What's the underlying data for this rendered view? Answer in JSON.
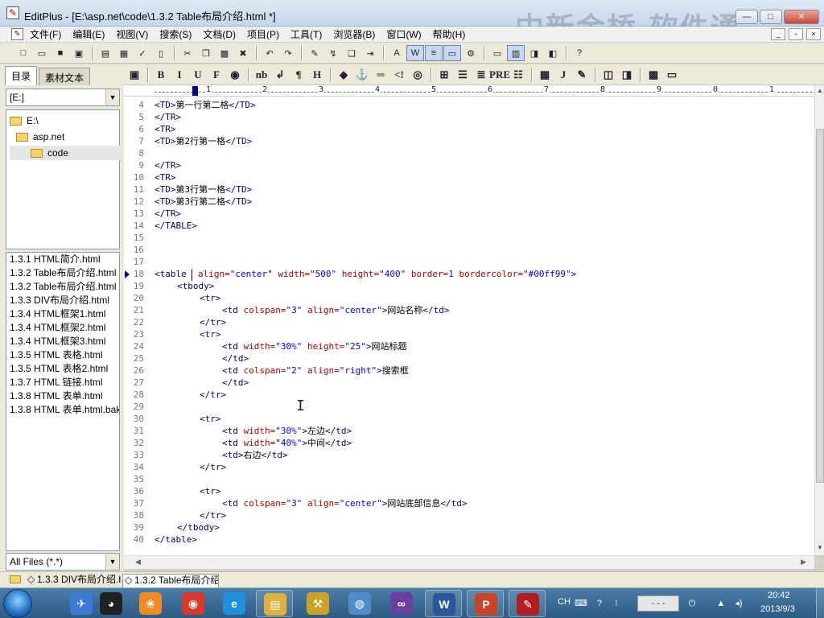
{
  "window": {
    "title": "EditPlus - [E:\\asp.net\\code\\1.3.2 Table布局介绍.html *]",
    "watermark": "中新金桥  软件通",
    "controls": {
      "minimize": "—",
      "maximize": "□",
      "close": "✕"
    }
  },
  "menu": {
    "items": [
      "文件(F)",
      "编辑(E)",
      "视图(V)",
      "搜索(S)",
      "文档(D)",
      "项目(P)",
      "工具(T)",
      "浏览器(B)",
      "窗口(W)",
      "帮助(H)"
    ],
    "mdi_controls": [
      "_",
      "▫",
      "×"
    ]
  },
  "toolbar1": {
    "icons": [
      {
        "name": "new-file-icon",
        "glyph": "□",
        "group_end": false
      },
      {
        "name": "open-file-icon",
        "glyph": "▭",
        "group_end": false
      },
      {
        "name": "save-icon",
        "glyph": "■",
        "group_end": false
      },
      {
        "name": "save-all-icon",
        "glyph": "▣",
        "group_end": true
      },
      {
        "name": "print-preview-icon",
        "glyph": "▤",
        "group_end": false
      },
      {
        "name": "print-icon",
        "glyph": "▦",
        "group_end": false
      },
      {
        "name": "spellcheck-icon",
        "glyph": "✓",
        "group_end": false
      },
      {
        "name": "page-icon",
        "glyph": "▯",
        "group_end": true
      },
      {
        "name": "cut-icon",
        "glyph": "✂",
        "group_end": false
      },
      {
        "name": "copy-icon",
        "glyph": "❐",
        "group_end": false
      },
      {
        "name": "paste-icon",
        "glyph": "▩",
        "group_end": false
      },
      {
        "name": "delete-icon",
        "glyph": "✖",
        "group_end": true
      },
      {
        "name": "undo-icon",
        "glyph": "↶",
        "group_end": false
      },
      {
        "name": "redo-icon",
        "glyph": "↷",
        "group_end": true
      },
      {
        "name": "find-icon",
        "glyph": "✎",
        "group_end": false
      },
      {
        "name": "replace-icon",
        "glyph": "↯",
        "group_end": false
      },
      {
        "name": "find-in-files-icon",
        "glyph": "❏",
        "group_end": false
      },
      {
        "name": "goto-icon",
        "glyph": "⇥",
        "group_end": true
      },
      {
        "name": "font-icon",
        "glyph": "A",
        "group_end": false
      },
      {
        "name": "word-wrap-icon",
        "glyph": "W",
        "group_end": false,
        "active": true
      },
      {
        "name": "line-number-icon",
        "glyph": "≡",
        "group_end": false,
        "active": true
      },
      {
        "name": "ruler-icon",
        "glyph": "▭",
        "group_end": false,
        "active": true
      },
      {
        "name": "settings-icon",
        "glyph": "⚙",
        "group_end": true
      },
      {
        "name": "window-icon",
        "glyph": "▭",
        "group_end": false
      },
      {
        "name": "tile-icon",
        "glyph": "▥",
        "group_end": false,
        "active": true
      },
      {
        "name": "browser-icon",
        "glyph": "◨",
        "group_end": false
      },
      {
        "name": "cliptext-icon",
        "glyph": "◧",
        "group_end": true
      },
      {
        "name": "help-icon",
        "glyph": "?",
        "group_end": false
      }
    ]
  },
  "toolbar2": {
    "icons": [
      {
        "name": "html-toolbar-icon",
        "glyph": "▣",
        "group_end": true
      },
      {
        "name": "bold-icon",
        "glyph": "B",
        "group_end": false
      },
      {
        "name": "italic-icon",
        "glyph": "I",
        "group_end": false
      },
      {
        "name": "underline-icon",
        "glyph": "U",
        "group_end": false
      },
      {
        "name": "font-tag-icon",
        "glyph": "F",
        "group_end": false
      },
      {
        "name": "color-icon",
        "glyph": "◉",
        "group_end": true
      },
      {
        "name": "nbsp-icon",
        "glyph": "nb",
        "group_end": false
      },
      {
        "name": "break-icon",
        "glyph": "↲",
        "group_end": false
      },
      {
        "name": "paragraph-icon",
        "glyph": "¶",
        "group_end": false
      },
      {
        "name": "heading-icon",
        "glyph": "H",
        "group_end": true
      },
      {
        "name": "link-icon",
        "glyph": "◆",
        "group_end": false
      },
      {
        "name": "anchor-icon",
        "glyph": "⚓",
        "group_end": false
      },
      {
        "name": "hr-icon",
        "glyph": "═",
        "group_end": false
      },
      {
        "name": "comment-icon",
        "glyph": "<!",
        "group_end": false
      },
      {
        "name": "image-icon",
        "glyph": "◎",
        "group_end": true
      },
      {
        "name": "table-icon",
        "glyph": "⊞",
        "group_end": false
      },
      {
        "name": "center-icon",
        "glyph": "☰",
        "group_end": false
      },
      {
        "name": "right-align-icon",
        "glyph": "≣",
        "group_end": false
      },
      {
        "name": "pre-icon",
        "glyph": "PRE",
        "group_end": false
      },
      {
        "name": "list-icon",
        "glyph": "☷",
        "group_end": true
      },
      {
        "name": "style-icon",
        "glyph": "▦",
        "group_end": false
      },
      {
        "name": "javascript-icon",
        "glyph": "J",
        "group_end": false
      },
      {
        "name": "script-icon",
        "glyph": "✎",
        "group_end": true
      },
      {
        "name": "form-icon",
        "glyph": "◫",
        "group_end": false
      },
      {
        "name": "input-icon",
        "glyph": "◨",
        "group_end": true
      },
      {
        "name": "color-picker-icon",
        "glyph": "▩",
        "group_end": false
      },
      {
        "name": "preview-icon",
        "glyph": "▭",
        "group_end": false
      }
    ]
  },
  "sidebar": {
    "tabs": [
      {
        "label": "目录",
        "active": true
      },
      {
        "label": "素材文本",
        "active": false
      }
    ],
    "drive": "[E:]",
    "tree": [
      {
        "label": "E:\\",
        "indent": 0,
        "selected": false
      },
      {
        "label": "asp.net",
        "indent": 1,
        "selected": false
      },
      {
        "label": "code",
        "indent": 2,
        "selected": true
      }
    ],
    "files": [
      "1.3.1 HTML简介.html",
      "1.3.2 Table布局介绍.html",
      "1.3.2 Table布局介绍.html",
      "1.3.3 DIV布局介绍.html",
      "1.3.4 HTML框架1.html",
      "1.3.4 HTML框架2.html",
      "1.3.4 HTML框架3.html",
      "1.3.5 HTML 表格.html",
      "1.3.5 HTML 表格2.html",
      "1.3.7 HTML 链接.html",
      "1.3.8 HTML 表单.html",
      "1.3.8 HTML 表单.html.bak"
    ],
    "filter": "All Files (*.*)"
  },
  "ruler": {
    "labels": [
      "1",
      "2",
      "3",
      "4",
      "5",
      "6",
      "7",
      "8",
      "9",
      "0",
      "1"
    ]
  },
  "editor": {
    "current_line": "18",
    "lines": [
      {
        "n": "4",
        "indent": 0,
        "parts": [
          [
            "tag",
            "<TD>"
          ],
          [
            "text",
            "第一行第二格"
          ],
          [
            "tag",
            "</TD>"
          ]
        ]
      },
      {
        "n": "5",
        "indent": 0,
        "parts": [
          [
            "tag",
            "</TR>"
          ]
        ]
      },
      {
        "n": "6",
        "indent": 0,
        "parts": [
          [
            "tag",
            "<TR>"
          ]
        ]
      },
      {
        "n": "7",
        "indent": 0,
        "parts": [
          [
            "tag",
            "<TD>"
          ],
          [
            "text",
            "第2行第一格"
          ],
          [
            "tag",
            "</TD>"
          ]
        ]
      },
      {
        "n": "8",
        "indent": 0,
        "parts": []
      },
      {
        "n": "9",
        "indent": 0,
        "parts": [
          [
            "tag",
            "</TR>"
          ]
        ]
      },
      {
        "n": "10",
        "indent": 0,
        "parts": [
          [
            "tag",
            "<TR>"
          ]
        ]
      },
      {
        "n": "11",
        "indent": 0,
        "parts": [
          [
            "tag",
            "<TD>"
          ],
          [
            "text",
            "第3行第一格"
          ],
          [
            "tag",
            "</TD>"
          ]
        ]
      },
      {
        "n": "12",
        "indent": 0,
        "parts": [
          [
            "tag",
            "<TD>"
          ],
          [
            "text",
            "第3行第二格"
          ],
          [
            "tag",
            "</TD>"
          ]
        ]
      },
      {
        "n": "13",
        "indent": 0,
        "parts": [
          [
            "tag",
            "</TR>"
          ]
        ]
      },
      {
        "n": "14",
        "indent": 0,
        "parts": [
          [
            "tag",
            "</TABLE>"
          ]
        ]
      },
      {
        "n": "15",
        "indent": 0,
        "parts": []
      },
      {
        "n": "16",
        "indent": 0,
        "parts": []
      },
      {
        "n": "17",
        "indent": 0,
        "parts": []
      },
      {
        "n": "18",
        "indent": 0,
        "parts": [
          [
            "tag",
            "<table "
          ],
          [
            "attr",
            " align="
          ],
          [
            "val",
            "\"center\""
          ],
          [
            "attr",
            " width="
          ],
          [
            "val",
            "\"500\""
          ],
          [
            "attr",
            " height="
          ],
          [
            "val",
            "\"400\""
          ],
          [
            "attr",
            " border="
          ],
          [
            "val",
            "1"
          ],
          [
            "attr",
            " bordercolor="
          ],
          [
            "val",
            "\"#00ff99\""
          ],
          [
            "tag",
            ">"
          ]
        ]
      },
      {
        "n": "19",
        "indent": 1,
        "parts": [
          [
            "tag",
            "<tbody>"
          ]
        ]
      },
      {
        "n": "20",
        "indent": 2,
        "parts": [
          [
            "tag",
            "<tr>"
          ]
        ]
      },
      {
        "n": "21",
        "indent": 3,
        "parts": [
          [
            "tag",
            "<td "
          ],
          [
            "attr",
            "colspan="
          ],
          [
            "val",
            "\"3\""
          ],
          [
            "attr",
            " align="
          ],
          [
            "val",
            "\"center\""
          ],
          [
            "tag",
            ">"
          ],
          [
            "text",
            "网站名称"
          ],
          [
            "tag",
            "</td>"
          ]
        ]
      },
      {
        "n": "22",
        "indent": 2,
        "parts": [
          [
            "tag",
            "</tr>"
          ]
        ]
      },
      {
        "n": "23",
        "indent": 2,
        "parts": [
          [
            "tag",
            "<tr>"
          ]
        ]
      },
      {
        "n": "24",
        "indent": 3,
        "parts": [
          [
            "tag",
            "<td "
          ],
          [
            "attr",
            "width="
          ],
          [
            "val",
            "\"30%\""
          ],
          [
            "attr",
            " height="
          ],
          [
            "val",
            "\"25\""
          ],
          [
            "tag",
            ">"
          ],
          [
            "text",
            "网站标题"
          ]
        ]
      },
      {
        "n": "25",
        "indent": 3,
        "parts": [
          [
            "tag",
            "</td>"
          ]
        ]
      },
      {
        "n": "26",
        "indent": 3,
        "parts": [
          [
            "tag",
            "<td "
          ],
          [
            "attr",
            "colspan="
          ],
          [
            "val",
            "\"2\""
          ],
          [
            "attr",
            " align="
          ],
          [
            "val",
            "\"right\""
          ],
          [
            "tag",
            ">"
          ],
          [
            "text",
            "搜索框"
          ]
        ]
      },
      {
        "n": "27",
        "indent": 3,
        "parts": [
          [
            "tag",
            "</td>"
          ]
        ]
      },
      {
        "n": "28",
        "indent": 2,
        "parts": [
          [
            "tag",
            "</tr>"
          ]
        ]
      },
      {
        "n": "29",
        "indent": 0,
        "parts": []
      },
      {
        "n": "30",
        "indent": 2,
        "parts": [
          [
            "tag",
            "<tr>"
          ]
        ]
      },
      {
        "n": "31",
        "indent": 3,
        "parts": [
          [
            "tag",
            "<td "
          ],
          [
            "attr",
            "width="
          ],
          [
            "val",
            "\"30%\""
          ],
          [
            "tag",
            ">"
          ],
          [
            "text",
            "左边"
          ],
          [
            "tag",
            "</td>"
          ]
        ]
      },
      {
        "n": "32",
        "indent": 3,
        "parts": [
          [
            "tag",
            "<td "
          ],
          [
            "attr",
            "width="
          ],
          [
            "val",
            "\"40%\""
          ],
          [
            "tag",
            ">"
          ],
          [
            "text",
            "中间"
          ],
          [
            "tag",
            "</td>"
          ]
        ]
      },
      {
        "n": "33",
        "indent": 3,
        "parts": [
          [
            "tag",
            "<td>"
          ],
          [
            "text",
            "右边"
          ],
          [
            "tag",
            "</td>"
          ]
        ]
      },
      {
        "n": "34",
        "indent": 2,
        "parts": [
          [
            "tag",
            "</tr>"
          ]
        ]
      },
      {
        "n": "35",
        "indent": 0,
        "parts": []
      },
      {
        "n": "36",
        "indent": 2,
        "parts": [
          [
            "tag",
            "<tr>"
          ]
        ]
      },
      {
        "n": "37",
        "indent": 3,
        "parts": [
          [
            "tag",
            "<td "
          ],
          [
            "attr",
            "colspan="
          ],
          [
            "val",
            "\"3\""
          ],
          [
            "attr",
            " align="
          ],
          [
            "val",
            "\"center\""
          ],
          [
            "tag",
            ">"
          ],
          [
            "text",
            "网站底部信息"
          ],
          [
            "tag",
            "</td>"
          ]
        ]
      },
      {
        "n": "38",
        "indent": 2,
        "parts": [
          [
            "tag",
            "</tr>"
          ]
        ]
      },
      {
        "n": "39",
        "indent": 1,
        "parts": [
          [
            "tag",
            "</tbody>"
          ]
        ]
      },
      {
        "n": "40",
        "indent": 0,
        "parts": [
          [
            "tag",
            "</table>"
          ]
        ]
      }
    ]
  },
  "doc_tabs": [
    {
      "label": "1.3.3 DIV布局介绍.h",
      "active": false
    },
    {
      "label": "1.3.2 Table布局介绍",
      "active": true
    }
  ],
  "taskbar": {
    "apps": [
      {
        "name": "kingsoft-bird-icon",
        "glyph": "✈",
        "color": "#3a7bd5",
        "pinned": false
      },
      {
        "name": "qq-icon",
        "glyph": "◕",
        "color": "#222222",
        "pinned": false
      },
      {
        "name": "gift-app-icon",
        "glyph": "❀",
        "color": "#f08a24",
        "pinned": false
      },
      {
        "name": "chrome-icon",
        "glyph": "◉",
        "color": "#d9382b",
        "pinned": false
      },
      {
        "name": "ie-icon",
        "glyph": "e",
        "color": "#1f8fe0",
        "pinned": false
      },
      {
        "name": "explorer-icon",
        "glyph": "▤",
        "color": "#e0b040",
        "pinned": true
      },
      {
        "name": "tools-app-icon",
        "glyph": "⚒",
        "color": "#c9a227",
        "pinned": false
      },
      {
        "name": "network-app-icon",
        "glyph": "◍",
        "color": "#4f8cc9",
        "pinned": false
      },
      {
        "name": "visual-studio-icon",
        "glyph": "∞",
        "color": "#6b3fa0",
        "pinned": false
      },
      {
        "name": "word-icon",
        "glyph": "W",
        "color": "#2b579a",
        "pinned": true
      },
      {
        "name": "powerpoint-icon",
        "glyph": "P",
        "color": "#c8452a",
        "pinned": true
      },
      {
        "name": "editplus-icon",
        "glyph": "✎",
        "color": "#b02020",
        "pinned": true
      }
    ],
    "tray": {
      "lang": "CH",
      "power_label": "- - -",
      "time": "20:42",
      "date": "2013/9/3"
    }
  }
}
